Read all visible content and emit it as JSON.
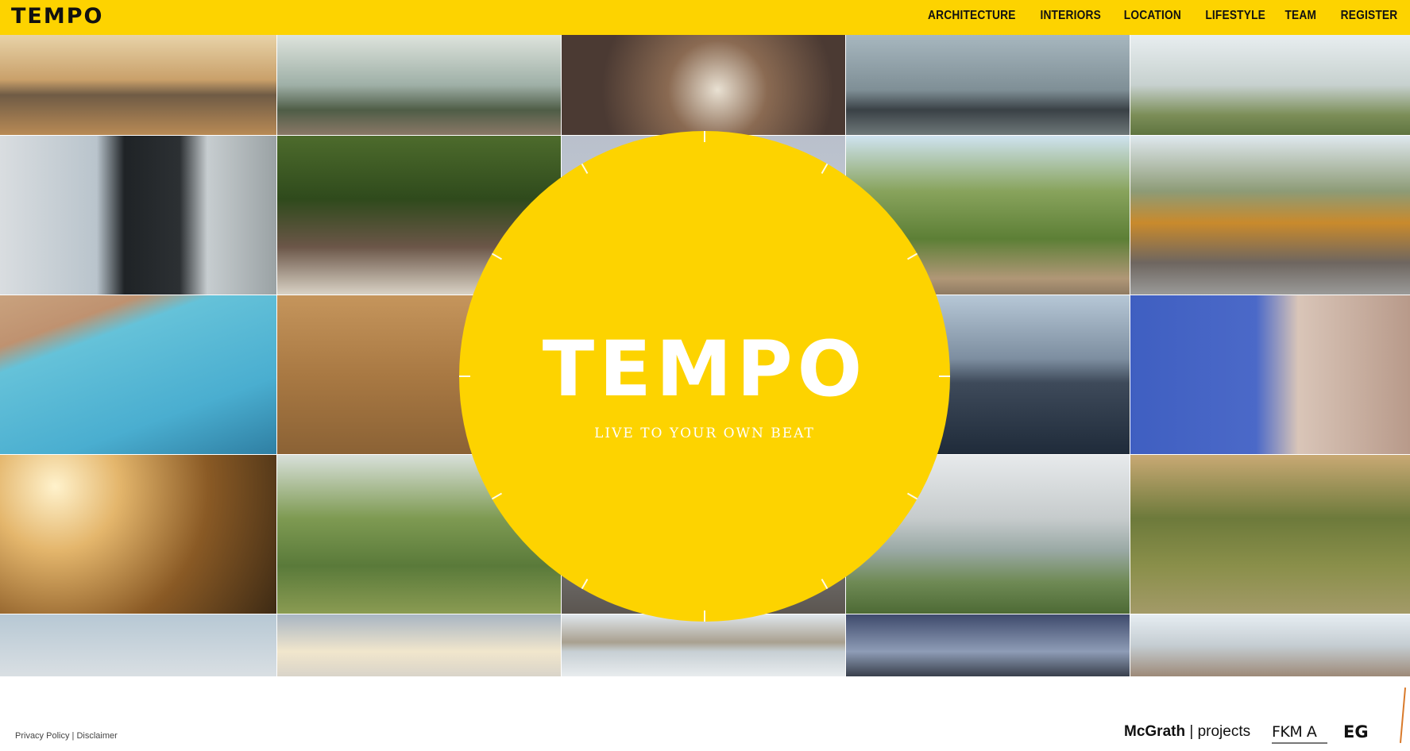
{
  "header": {
    "logo": "TEMPO",
    "nav": [
      "ARCHITECTURE",
      "INTERIORS",
      "LOCATION",
      "LIFESTYLE",
      "TEAM",
      "REGISTER"
    ]
  },
  "hero": {
    "title": "TEMPO",
    "tagline": "LIVE TO YOUR OWN BEAT"
  },
  "footer": {
    "privacy": "Privacy Policy",
    "separator": "|",
    "disclaimer": "Disclaimer",
    "partners": {
      "mcgrath": "McGrath",
      "projects": "projects",
      "fkma": "FKM A",
      "eg": "EG"
    }
  },
  "colors": {
    "brand_yellow": "#fdd300",
    "text_dark": "#111111",
    "eg_accent": "#d97a2b"
  },
  "photo_grid": {
    "tiles": [
      "marina at sunset",
      "river view from deck",
      "outdoor dining table",
      "boat on river",
      "cyclist by river",
      "man looking at building",
      "couple dining outdoors",
      "sky",
      "couple walking on path",
      "apartment building",
      "swimming pool",
      "rower on river",
      "sunset river",
      "bridge at dusk",
      "blue apartment building",
      "sunset through trees",
      "runner stretching in park",
      "city skyline",
      "couple by river",
      "woman running in park",
      "sky",
      "sunset sky",
      "city across water",
      "riverside evening",
      "covered walkway"
    ]
  }
}
